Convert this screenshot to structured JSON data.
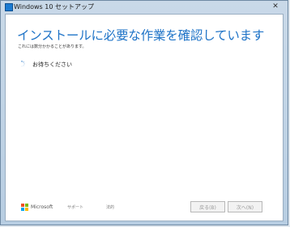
{
  "window": {
    "title": "Windows 10 セットアップ",
    "close_glyph": "✕"
  },
  "main": {
    "heading": "インストールに必要な作業を確認しています",
    "subtext": "これには数分かかることがあります。",
    "status": "お待ちください"
  },
  "footer": {
    "brand": "Microsoft",
    "support_link": "サポート",
    "legal_link": "法的",
    "back_button": "戻る(B)",
    "next_button": "次へ(N)"
  },
  "colors": {
    "heading": "#1e73c7",
    "window_frame": "#b7cde2",
    "ms_red": "#f25022",
    "ms_green": "#7fba00",
    "ms_blue": "#00a4ef",
    "ms_yellow": "#ffb900"
  },
  "icons": {
    "app": "windows-setup-icon",
    "spinner": "loading-spinner-icon",
    "logo": "microsoft-logo-icon"
  }
}
